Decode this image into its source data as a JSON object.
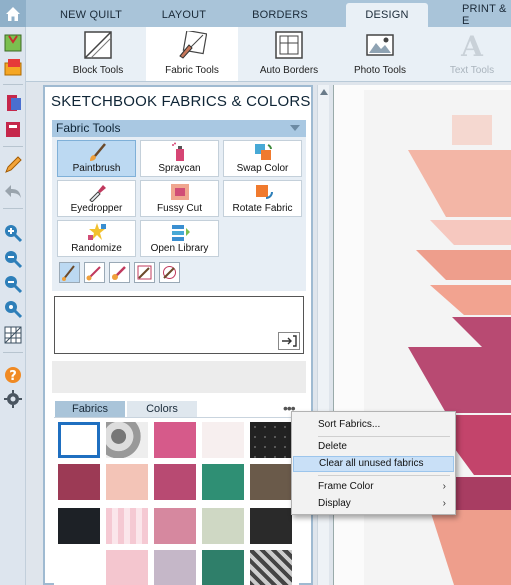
{
  "tabs": [
    "NEW QUILT",
    "LAYOUT",
    "BORDERS",
    "DESIGN",
    "PRINT & E"
  ],
  "active_tab": "DESIGN",
  "ribbon": {
    "items": [
      "Block Tools",
      "Fabric Tools",
      "Auto Borders",
      "Photo Tools",
      "Text Tools"
    ],
    "active": "Fabric Tools",
    "disabled": "Text Tools"
  },
  "panel": {
    "title": "SKETCHBOOK FABRICS & COLORS",
    "section_title": "Fabric Tools",
    "tools": [
      "Paintbrush",
      "Spraycan",
      "Swap Color",
      "Eyedropper",
      "Fussy Cut",
      "Rotate Fabric",
      "Randomize",
      "Open Library"
    ],
    "active_tool": "Paintbrush",
    "tabs": [
      "Fabrics",
      "Colors"
    ],
    "active_tab": "Fabrics"
  },
  "context_menu": {
    "items": [
      {
        "label": "Sort Fabrics...",
        "submenu": false
      },
      {
        "label": "Delete",
        "submenu": false
      },
      {
        "label": "Clear all unused fabrics",
        "submenu": false
      },
      {
        "label": "Frame Color",
        "submenu": true
      },
      {
        "label": "Display",
        "submenu": true
      }
    ],
    "highlighted": "Clear all unused fabrics",
    "submenu_glyph": "›"
  },
  "more_glyph": "•••",
  "colors": {
    "accent": "#a9c8e2",
    "quilt_pink": "#ee9e8c",
    "quilt_magenta": "#b84a72",
    "quilt_light": "#f6c8bf"
  }
}
